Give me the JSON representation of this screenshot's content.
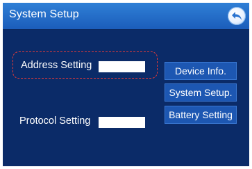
{
  "header": {
    "title": "System Setup",
    "back_icon": "back-arrow-icon"
  },
  "settings": {
    "address_label": "Address Setting",
    "address_value": "",
    "protocol_label": "Protocol Setting",
    "protocol_value": ""
  },
  "menu": {
    "items": [
      {
        "label": "Device Info."
      },
      {
        "label": "System Setup."
      },
      {
        "label": "Battery Setting"
      }
    ]
  },
  "colors": {
    "background": "#0b2b68",
    "header": "#2f7fd6",
    "button": "#1d57b2",
    "focus": "#e23a3a"
  }
}
